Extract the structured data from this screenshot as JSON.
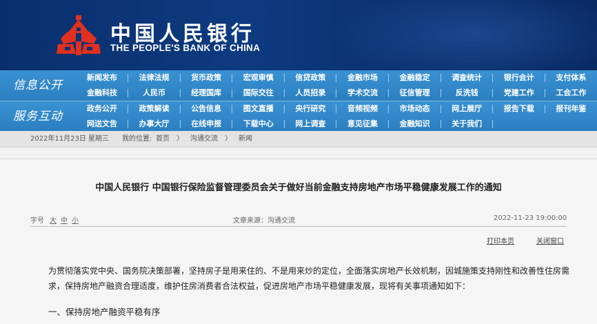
{
  "header": {
    "bank_name_cn": "中国人民银行",
    "bank_name_en": "THE PEOPLE'S BANK OF CHINA",
    "logo_icon": "pboc-logo-icon",
    "colors": {
      "banner": "#0a2f6c",
      "logo": "#e03020",
      "nav": "#2f86c6"
    }
  },
  "nav": {
    "group1_label": "信息公开",
    "group2_label": "服务互动",
    "group1_items": [
      "新闻发布",
      "法律法规",
      "货币政策",
      "宏观审慎",
      "信贷政策",
      "金融市场",
      "金融稳定",
      "调查统计",
      "银行会计",
      "支付体系",
      "金融科技",
      "人民币",
      "经理国库",
      "国际交往",
      "人员招录",
      "学术交流",
      "征信管理",
      "反洗钱",
      "党建工作",
      "工会工作"
    ],
    "group2_items": [
      "政务公开",
      "政策解读",
      "公告信息",
      "图文直播",
      "央行研究",
      "音频视频",
      "市场动态",
      "网上展厅",
      "报告下载",
      "报刊年鉴",
      "网送文告",
      "办事大厅",
      "在线申报",
      "下载中心",
      "网上调查",
      "意见征集",
      "金融知识",
      "关于我们"
    ]
  },
  "breadcrumb": {
    "date": "2022年11月23日",
    "weekday": "星期三",
    "location_label": "我的位置:",
    "home": "首页",
    "sep1": "〉",
    "level1": "沟通交流",
    "sep2": "〉",
    "level2": "新闻"
  },
  "article": {
    "title": "中国人民银行  中国银行保险监督管理委员会关于做好当前金融支持房地产市场平稳健康发展工作的通知",
    "font_label": "字号",
    "size_large": "大",
    "size_medium": "中",
    "size_small": "小",
    "source": "文章来源：沟通交流",
    "datetime": "2022-11-23  19:00:00",
    "print_label": "打印本页",
    "close_label": "关闭窗口",
    "paragraph1": "为贯彻落实党中央、国务院决策部署，坚持房子是用来住的、不是用来炒的定位，全面落实房地产长效机制，因城施策支持刚性和改善性住房需求，保持房地产融资合理适度，维护住房消费者合法权益，促进房地产市场平稳健康发展，现将有关事项通知如下：",
    "section1": "一、保持房地产融资平稳有序"
  }
}
